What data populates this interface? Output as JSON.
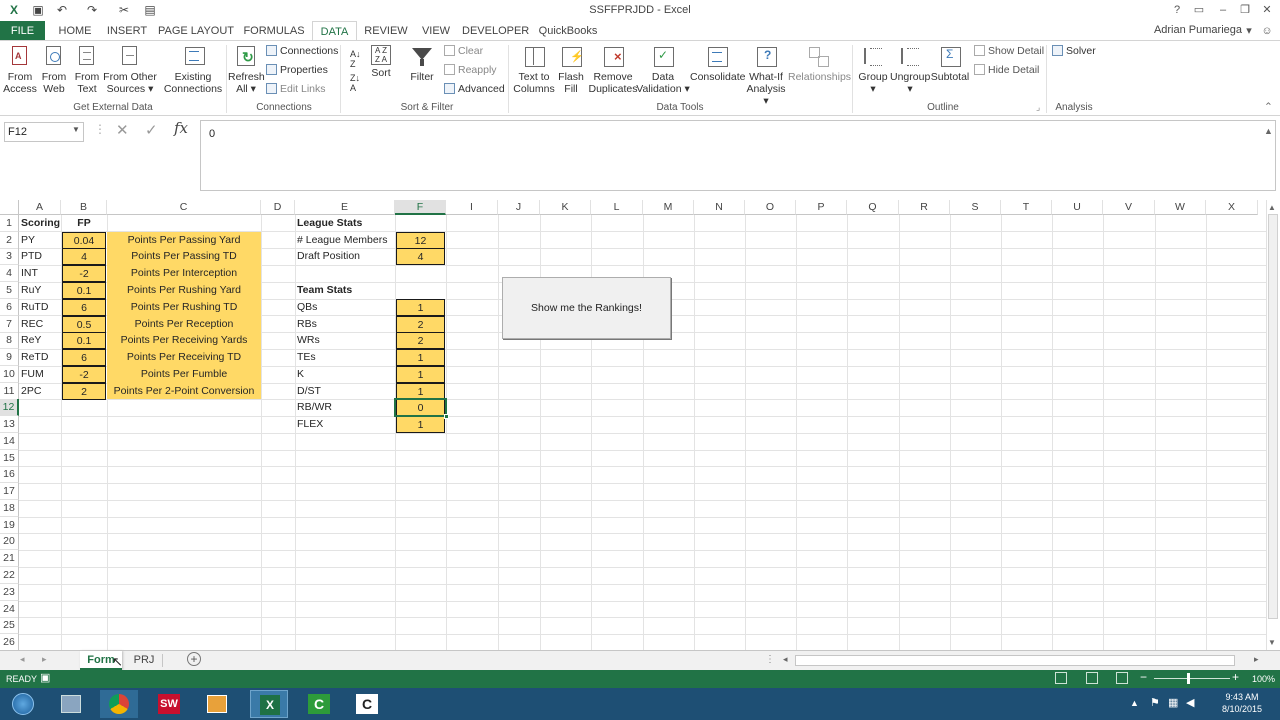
{
  "window": {
    "title": "SSFFPRJDD - Excel",
    "user": "Adrian Pumariega"
  },
  "tabs": [
    {
      "label": "FILE"
    },
    {
      "label": "HOME"
    },
    {
      "label": "INSERT"
    },
    {
      "label": "PAGE LAYOUT"
    },
    {
      "label": "FORMULAS"
    },
    {
      "label": "DATA"
    },
    {
      "label": "REVIEW"
    },
    {
      "label": "VIEW"
    },
    {
      "label": "DEVELOPER"
    },
    {
      "label": "QuickBooks"
    }
  ],
  "ribbon": {
    "from_access": [
      "From",
      "Access"
    ],
    "from_web": [
      "From",
      "Web"
    ],
    "from_text": [
      "From",
      "Text"
    ],
    "from_other": [
      "From Other",
      "Sources ▾"
    ],
    "existing": [
      "Existing",
      "Connections"
    ],
    "refresh": [
      "Refresh",
      "All ▾"
    ],
    "connections": "Connections",
    "properties": "Properties",
    "edit_links": "Edit Links",
    "sort": "Sort",
    "filter": "Filter",
    "clear": "Clear",
    "reapply": "Reapply",
    "advanced": "Advanced",
    "text_to_columns": [
      "Text to",
      "Columns"
    ],
    "flash_fill": [
      "Flash",
      "Fill"
    ],
    "remove_dup": [
      "Remove",
      "Duplicates"
    ],
    "data_val": [
      "Data",
      "Validation ▾"
    ],
    "consolidate": "Consolidate",
    "whatif": [
      "What-If",
      "Analysis ▾"
    ],
    "relationships": "Relationships",
    "group": [
      "Group",
      "▾"
    ],
    "ungroup": [
      "Ungroup",
      "▾"
    ],
    "subtotal": "Subtotal",
    "show_detail": "Show Detail",
    "hide_detail": "Hide Detail",
    "solver": "Solver",
    "groups": {
      "get_external": "Get External Data",
      "connections": "Connections",
      "sort_filter": "Sort & Filter",
      "data_tools": "Data Tools",
      "outline": "Outline",
      "analysis": "Analysis"
    }
  },
  "formula_bar": {
    "name_box": "F12",
    "formula": "0"
  },
  "columns": [
    "A",
    "B",
    "C",
    "D",
    "E",
    "F",
    "I",
    "J",
    "K",
    "L",
    "M",
    "N",
    "O",
    "P",
    "Q",
    "R",
    "S",
    "T",
    "U",
    "V",
    "W",
    "X"
  ],
  "rows": [
    "1",
    "2",
    "3",
    "4",
    "5",
    "6",
    "7",
    "8",
    "9",
    "10",
    "11",
    "12",
    "13",
    "14",
    "15",
    "16",
    "17",
    "18",
    "19",
    "20",
    "21",
    "22",
    "23",
    "24",
    "25",
    "26"
  ],
  "scoring": {
    "header_a": "Scoring",
    "header_b": "FP",
    "items": [
      {
        "code": "PY",
        "value": "0.04",
        "desc": "Points Per Passing Yard"
      },
      {
        "code": "PTD",
        "value": "4",
        "desc": "Points Per Passing TD"
      },
      {
        "code": "INT",
        "value": "-2",
        "desc": "Points Per Interception"
      },
      {
        "code": "RuY",
        "value": "0.1",
        "desc": "Points Per Rushing Yard"
      },
      {
        "code": "RuTD",
        "value": "6",
        "desc": "Points Per Rushing TD"
      },
      {
        "code": "REC",
        "value": "0.5",
        "desc": "Points Per Reception"
      },
      {
        "code": "ReY",
        "value": "0.1",
        "desc": "Points Per Receiving Yards"
      },
      {
        "code": "ReTD",
        "value": "6",
        "desc": "Points Per Receiving TD"
      },
      {
        "code": "FUM",
        "value": "-2",
        "desc": "Points Per Fumble"
      },
      {
        "code": "2PC",
        "value": "2",
        "desc": "Points Per 2-Point Conversion"
      }
    ]
  },
  "league": {
    "header": "League Stats",
    "members_label": "# League Members",
    "members": "12",
    "draft_label": "Draft Position",
    "draft": "4"
  },
  "team": {
    "header": "Team Stats",
    "items": [
      {
        "label": "QBs",
        "value": "1"
      },
      {
        "label": "RBs",
        "value": "2"
      },
      {
        "label": "WRs",
        "value": "2"
      },
      {
        "label": "TEs",
        "value": "1"
      },
      {
        "label": "K",
        "value": "1"
      },
      {
        "label": "D/ST",
        "value": "1"
      },
      {
        "label": "RB/WR",
        "value": "0"
      },
      {
        "label": "FLEX",
        "value": "1"
      }
    ]
  },
  "macro_button": "Show me the Rankings!",
  "sheets": [
    {
      "label": "Form"
    },
    {
      "label": "PRJ"
    }
  ],
  "status": {
    "left": "READY",
    "zoom": "100%"
  },
  "clock": {
    "time": "9:43 AM",
    "date": "8/10/2015"
  }
}
